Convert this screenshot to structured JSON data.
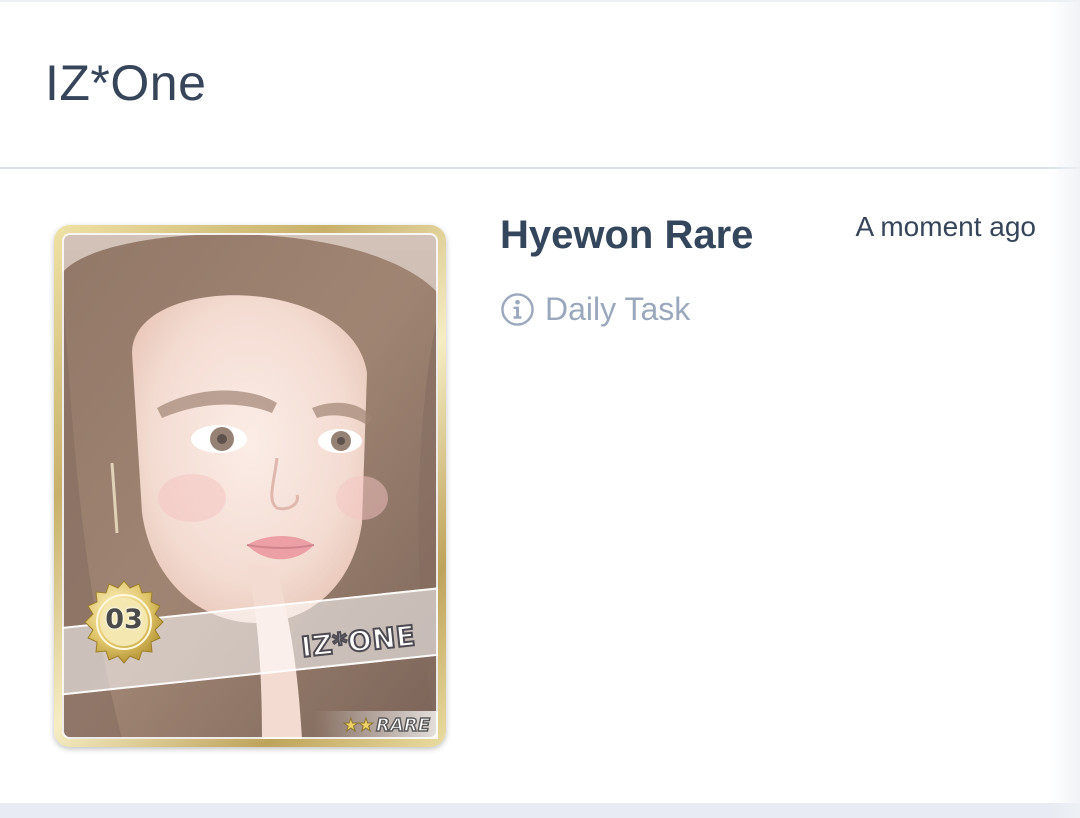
{
  "header": {
    "title": "IZ*One"
  },
  "card": {
    "name": "Hyewon Rare",
    "time": "A moment ago",
    "source": {
      "icon": "info-icon",
      "label": "Daily Task"
    },
    "photocard": {
      "number": "03",
      "group_logo": "IZ*ONE",
      "rarity_stars": "★★",
      "rarity_label": "RARE",
      "photo_icon": "member-portrait-photo"
    }
  },
  "colors": {
    "title_text": "#36455a",
    "name_text": "#34465c",
    "muted_text": "#9aa8bd",
    "card_gold": "#d7c27c",
    "divider": "#dde3e8",
    "bottom_bar": "#e8ebf3"
  }
}
